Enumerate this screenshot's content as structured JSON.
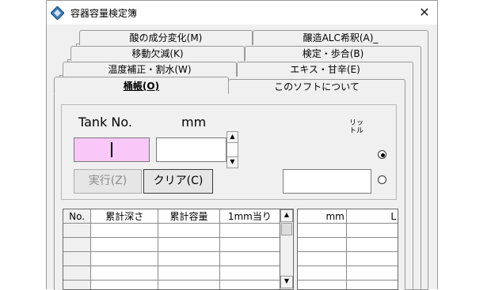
{
  "window": {
    "title": "容器容量検定簿",
    "close_glyph": "✕"
  },
  "tabs": {
    "row1": [
      "酸の成分変化(M)",
      "醸造ALC希釈(A)_"
    ],
    "row2": [
      "移動欠減(K)",
      "検定・歩合(B)"
    ],
    "row3": [
      "温度補正・割水(W)",
      "エキス・甘辛(E)"
    ],
    "row4": [
      "桶帳(O)",
      "このソフトについて"
    ]
  },
  "form": {
    "tank_label": "Tank No.",
    "mm_label": "mm",
    "liter_label_line1": "リッ",
    "liter_label_line2": "トル",
    "execute_label": "実行(Z)",
    "clear_label": "クリア(C)",
    "tank_value": "",
    "mm_value": "",
    "liter_value": "",
    "radio_top_selected": true,
    "radio_bottom_selected": false
  },
  "table": {
    "headers": [
      "No.",
      "累計深さ",
      "累計容量",
      "1mm当り"
    ],
    "rows": [
      [
        "",
        "",
        "",
        ""
      ],
      [
        "",
        "",
        "",
        ""
      ],
      [
        "",
        "",
        "",
        ""
      ],
      [
        "",
        "",
        "",
        ""
      ],
      [
        "",
        "",
        "",
        ""
      ]
    ]
  },
  "side_table": {
    "headers": [
      "mm",
      "L"
    ],
    "rows": [
      [
        "",
        ""
      ],
      [
        "",
        ""
      ],
      [
        "",
        ""
      ],
      [
        "",
        ""
      ],
      [
        "",
        ""
      ]
    ]
  },
  "icons": {
    "app": "diamond-app-icon",
    "scroll_up": "▲",
    "scroll_down": "▼",
    "spin_up": "▲",
    "spin_down": "▼"
  }
}
